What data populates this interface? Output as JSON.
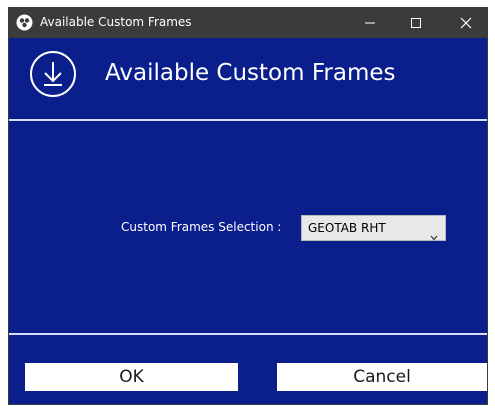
{
  "window": {
    "title": "Available Custom Frames",
    "icons": {
      "app": "app-logo-icon",
      "minimize": "minimize-icon",
      "maximize": "maximize-icon",
      "close": "close-icon"
    }
  },
  "header": {
    "title": "Available Custom Frames",
    "icon": "download-circle-icon"
  },
  "form": {
    "selection_label": "Custom Frames Selection :",
    "selection_value": "GEOTAB RHT"
  },
  "buttons": {
    "ok_label": "OK",
    "cancel_label": "Cancel"
  },
  "colors": {
    "background": "#0a1e8c",
    "titlebar": "#3b3b3b",
    "divider": "#d9dcf0",
    "button": "#ffffff"
  }
}
